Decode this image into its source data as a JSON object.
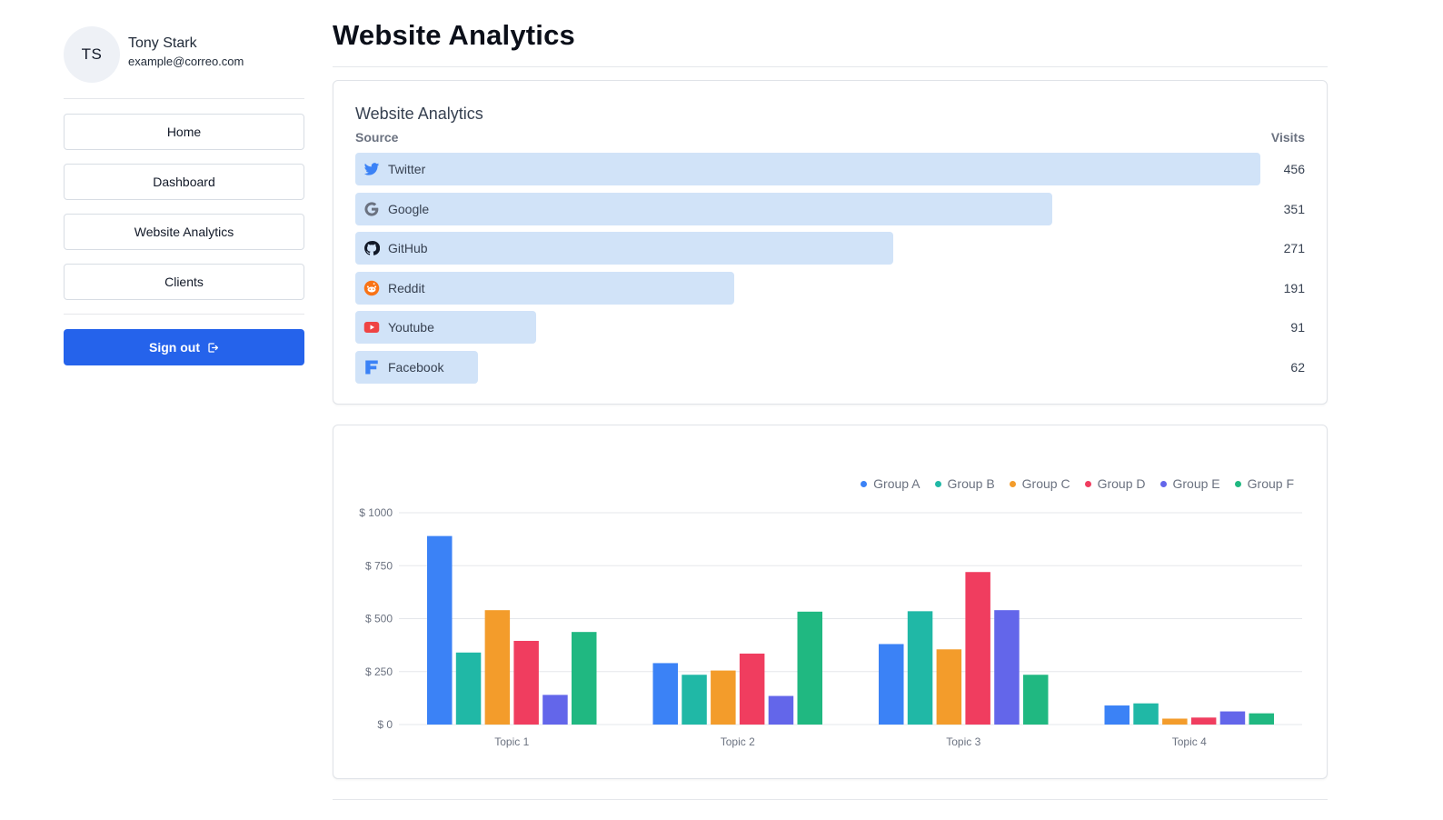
{
  "user": {
    "initials": "TS",
    "name": "Tony Stark",
    "email": "example@correo.com"
  },
  "nav": [
    {
      "label": "Home"
    },
    {
      "label": "Dashboard"
    },
    {
      "label": "Website Analytics"
    },
    {
      "label": "Clients"
    }
  ],
  "signout_label": "Sign out",
  "page_title": "Website Analytics",
  "analytics": {
    "title": "Website Analytics",
    "source_header": "Source",
    "visits_header": "Visits",
    "max_visits": 456,
    "rows": [
      {
        "source": "Twitter",
        "visits": 456,
        "icon": "twitter-icon",
        "color": "#3b82f6"
      },
      {
        "source": "Google",
        "visits": 351,
        "icon": "google-icon",
        "color": "#6b7280"
      },
      {
        "source": "GitHub",
        "visits": 271,
        "icon": "github-icon",
        "color": "#111827"
      },
      {
        "source": "Reddit",
        "visits": 191,
        "icon": "reddit-icon",
        "color": "#f97316"
      },
      {
        "source": "Youtube",
        "visits": 91,
        "icon": "youtube-icon",
        "color": "#ef4444"
      },
      {
        "source": "Facebook",
        "visits": 62,
        "icon": "facebook-icon",
        "color": "#3b82f6"
      }
    ]
  },
  "chart_data": {
    "type": "bar",
    "categories": [
      "Topic 1",
      "Topic 2",
      "Topic 3",
      "Topic 4"
    ],
    "ylim": [
      0,
      1000
    ],
    "yticks": [
      0,
      250,
      500,
      750,
      1000
    ],
    "ytick_labels": [
      "$ 0",
      "$ 250",
      "$ 500",
      "$ 750",
      "$ 1000"
    ],
    "grid": true,
    "legend_position": "top-right",
    "series": [
      {
        "name": "Group A",
        "color": "#3b82f6",
        "values": [
          890,
          290,
          380,
          90
        ]
      },
      {
        "name": "Group B",
        "color": "#20b8a6",
        "values": [
          340,
          235,
          535,
          100
        ]
      },
      {
        "name": "Group C",
        "color": "#f39c2b",
        "values": [
          540,
          255,
          355,
          28
        ]
      },
      {
        "name": "Group D",
        "color": "#f03d5f",
        "values": [
          395,
          335,
          720,
          33
        ]
      },
      {
        "name": "Group E",
        "color": "#6366ea",
        "values": [
          140,
          135,
          540,
          62
        ]
      },
      {
        "name": "Group F",
        "color": "#20b881",
        "values": [
          437,
          533,
          235,
          53
        ]
      }
    ]
  }
}
